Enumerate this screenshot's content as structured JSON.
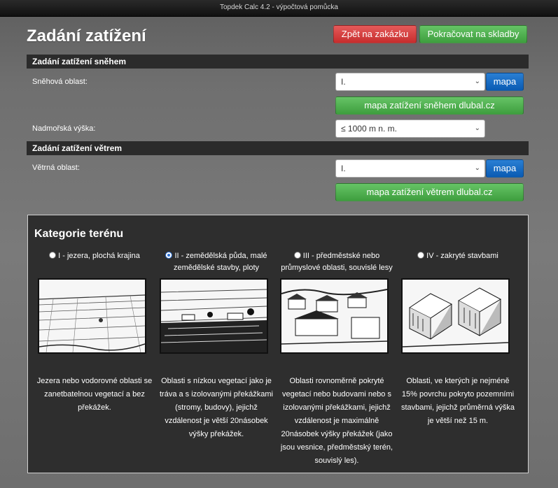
{
  "window": {
    "title": "Topdek Calc 4.2 - výpočtová pomůcka"
  },
  "page": {
    "title": "Zadání zatížení"
  },
  "actions": {
    "back_label": "Zpět na zakázku",
    "continue_label": "Pokračovat na skladby"
  },
  "snow": {
    "header": "Zadání zatížení sněhem",
    "area_label": "Sněhová oblast:",
    "area_value": "I.",
    "map_button": "mapa",
    "dlubal_button": "mapa zatížení sněhem dlubal.cz",
    "altitude_label": "Nadmořská výška:",
    "altitude_value": "≤ 1000 m n. m."
  },
  "wind": {
    "header": "Zadání zatížení větrem",
    "area_label": "Větrná oblast:",
    "area_value": "I.",
    "map_button": "mapa",
    "dlubal_button": "mapa zatížení větrem dlubal.cz"
  },
  "terrain": {
    "title": "Kategorie terénu",
    "selected_index": 1,
    "categories": [
      {
        "label": "I - jezera, plochá krajina",
        "description": "Jezera nebo vodorovné oblasti se zanetbatelnou vegetací a bez překážek."
      },
      {
        "label": "II - zemědělská půda, malé zemědělské stavby, ploty",
        "description": "Oblasti s nízkou vegetací jako je tráva a s izolovanými překážkami (stromy, budovy), jejichž vzdálenost je větší 20násobek výšky překážek."
      },
      {
        "label": "III - předměstské nebo průmyslové oblasti, souvislé lesy",
        "description": "Oblasti rovnoměrně pokryté vegetací nebo budovami nebo s izolovanými překážkami, jejichž vzdálenost je maximálně 20násobek výšky překážek (jako jsou vesnice, předměstský terén, souvislý les)."
      },
      {
        "label": "IV - zakryté stavbami",
        "description": "Oblasti, ve kterých je nejméně 15% povrchu pokryto pozemními stavbami, jejichž průměrná výška je větší než 15 m."
      }
    ]
  },
  "colors": {
    "accent_red": "#d94343",
    "accent_green": "#4caf50",
    "accent_blue": "#0a66c2"
  }
}
